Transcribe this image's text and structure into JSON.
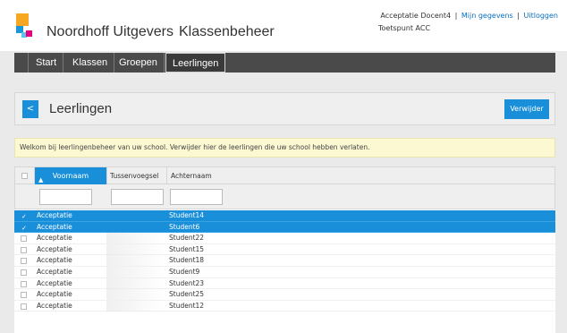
{
  "header": {
    "brand": "Noordhoff Uitgevers",
    "app_title": "Klassenbeheer",
    "user_name": "Acceptatie Docent4",
    "my_details_link": "Mijn gegevens",
    "logout_link": "Uitloggen",
    "school": "Toetspunt ACC",
    "separator": "|"
  },
  "nav": {
    "items": [
      {
        "label": "Start"
      },
      {
        "label": "Klassen"
      },
      {
        "label": "Groepen"
      },
      {
        "label": "Leerlingen"
      }
    ]
  },
  "page": {
    "back_label": "<",
    "title": "Leerlingen",
    "delete_label": "Verwijder",
    "info": "Welkom bij leerlingenbeheer van uw school. Verwijder hier de leerlingen die uw school hebben verlaten."
  },
  "table": {
    "sort_indicator": "▲",
    "columns": {
      "first": "Voornaam",
      "middle": "Tussenvoegsel",
      "last": "Achternaam"
    },
    "rows": [
      {
        "first": "Acceptatie",
        "middle": "",
        "last": "Student14",
        "selected": true
      },
      {
        "first": "Acceptatie",
        "middle": "",
        "last": "Student6",
        "selected": true
      },
      {
        "first": "Acceptatie",
        "middle": "",
        "last": "Student22",
        "selected": false
      },
      {
        "first": "Acceptatie",
        "middle": "",
        "last": "Student15",
        "selected": false
      },
      {
        "first": "Acceptatie",
        "middle": "",
        "last": "Student18",
        "selected": false
      },
      {
        "first": "Acceptatie",
        "middle": "",
        "last": "Student9",
        "selected": false
      },
      {
        "first": "Acceptatie",
        "middle": "",
        "last": "Student23",
        "selected": false
      },
      {
        "first": "Acceptatie",
        "middle": "",
        "last": "Student25",
        "selected": false
      },
      {
        "first": "Acceptatie",
        "middle": "",
        "last": "Student12",
        "selected": false
      }
    ],
    "check_mark": "✓"
  },
  "colors": {
    "accent": "#1a8fd9",
    "nav_bg": "#4a4a4a",
    "info_bg": "#fbf8d2",
    "logo_orange": "#f7a823",
    "logo_blue": "#1a99d6",
    "logo_pink": "#e6007e"
  }
}
